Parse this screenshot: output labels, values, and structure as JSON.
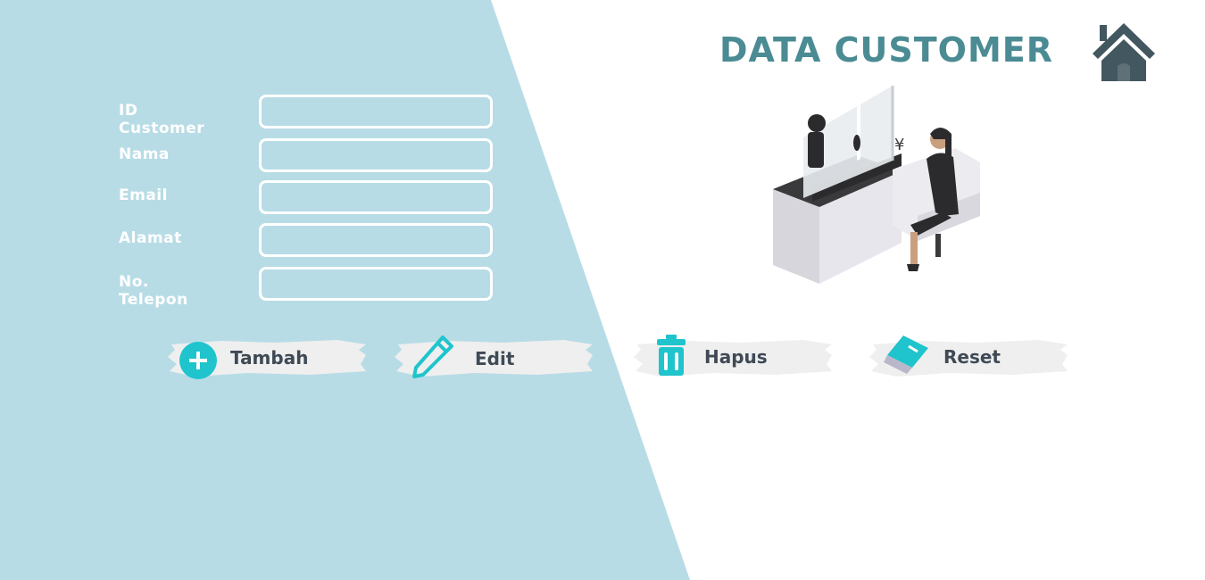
{
  "header": {
    "title": "DATA CUSTOMER",
    "home_icon": "home-icon"
  },
  "form": {
    "fields": [
      {
        "label": "ID Customer",
        "value": "",
        "placeholder": ""
      },
      {
        "label": "Nama",
        "value": "",
        "placeholder": ""
      },
      {
        "label": "Email",
        "value": "",
        "placeholder": ""
      },
      {
        "label": "Alamat",
        "value": "",
        "placeholder": ""
      },
      {
        "label": "No. Telepon",
        "value": "",
        "placeholder": ""
      }
    ]
  },
  "actions": [
    {
      "label": "Tambah",
      "icon": "plus-circle-icon"
    },
    {
      "label": "Edit",
      "icon": "pencil-icon"
    },
    {
      "label": "Hapus",
      "icon": "trash-icon"
    },
    {
      "label": "Reset",
      "icon": "eraser-icon"
    }
  ],
  "colors": {
    "panel": "#b8dce6",
    "title": "#4b8b93",
    "home": "#435760",
    "accent": "#1fc4cc",
    "button_bg": "#efefef",
    "button_text": "#3f4a55"
  }
}
